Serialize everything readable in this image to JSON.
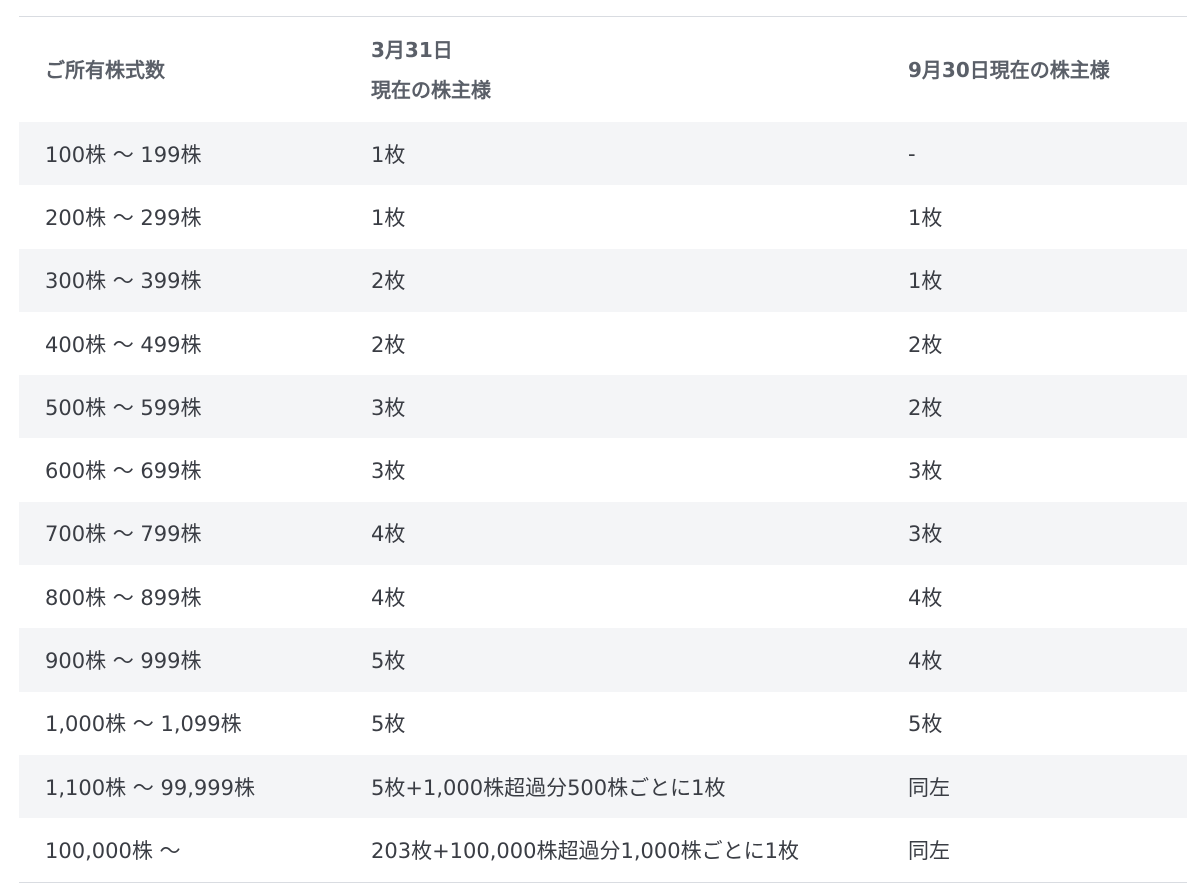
{
  "table": {
    "headers": {
      "shares": "ご所有株式数",
      "march_line1": "3月31日",
      "march_line2": "現在の株主様",
      "september": "9月30日現在の株主様"
    },
    "rows": [
      {
        "shares": "100株 〜 199株",
        "march": "1枚",
        "september": "-"
      },
      {
        "shares": "200株 〜 299株",
        "march": "1枚",
        "september": "1枚"
      },
      {
        "shares": "300株 〜 399株",
        "march": "2枚",
        "september": "1枚"
      },
      {
        "shares": "400株 〜 499株",
        "march": "2枚",
        "september": "2枚"
      },
      {
        "shares": "500株 〜 599株",
        "march": "3枚",
        "september": "2枚"
      },
      {
        "shares": "600株 〜 699株",
        "march": "3枚",
        "september": "3枚"
      },
      {
        "shares": "700株 〜 799株",
        "march": "4枚",
        "september": "3枚"
      },
      {
        "shares": "800株 〜 899株",
        "march": "4枚",
        "september": "4枚"
      },
      {
        "shares": "900株 〜 999株",
        "march": "5枚",
        "september": "4枚"
      },
      {
        "shares": "1,000株 〜 1,099株",
        "march": "5枚",
        "september": "5枚"
      },
      {
        "shares": "1,100株 〜 99,999株",
        "march": "5枚+1,000株超過分500株ごとに1枚",
        "september": "同左"
      },
      {
        "shares": "100,000株 〜",
        "march": "203枚+100,000株超過分1,000株ごとに1枚",
        "september": "同左"
      }
    ]
  }
}
